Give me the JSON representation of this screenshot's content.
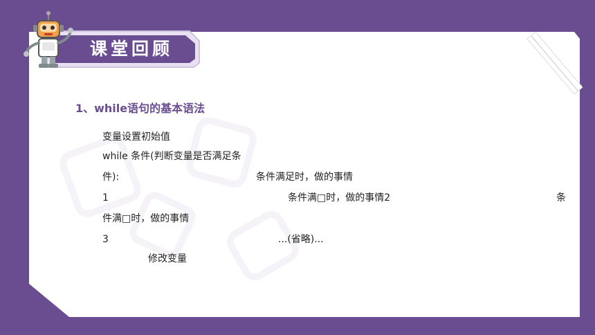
{
  "header": {
    "title": "课堂回顾"
  },
  "section": {
    "heading": "1、while语句的基本语法"
  },
  "body_lines": [
    "变量设置初始值",
    "while   条件(判断变量是否满足条",
    "件):",
    "条件满足时，做的事情",
    "1",
    "条件满□时，做的事情2",
    "条",
    "件满□时，做的事情",
    "3",
    "...(省略)...",
    "修改变量"
  ],
  "colors": {
    "background": "#6a4d91",
    "accent": "#6a4d91",
    "card": "#ffffff",
    "text": "#222222"
  },
  "icons": {
    "mascot": "robot-icon"
  }
}
